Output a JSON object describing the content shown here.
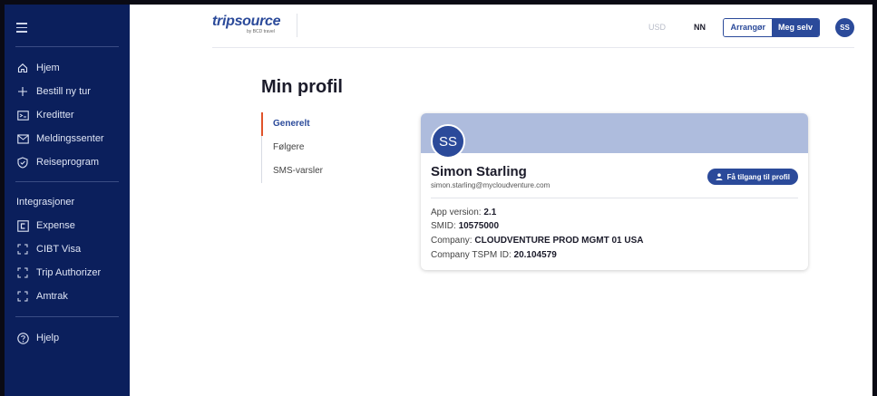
{
  "sidebar": {
    "items": [
      {
        "label": "Hjem",
        "icon": "home-icon"
      },
      {
        "label": "Bestill ny tur",
        "icon": "plus-icon"
      },
      {
        "label": "Kreditter",
        "icon": "credit-icon"
      },
      {
        "label": "Meldingssenter",
        "icon": "mail-icon"
      },
      {
        "label": "Reiseprogram",
        "icon": "shield-check-icon"
      }
    ],
    "section_title": "Integrasjoner",
    "integrations": [
      {
        "label": "Expense",
        "icon": "expense-icon"
      },
      {
        "label": "CIBT Visa",
        "icon": "bracket-icon"
      },
      {
        "label": "Trip Authorizer",
        "icon": "bracket-icon"
      },
      {
        "label": "Amtrak",
        "icon": "bracket-icon"
      }
    ],
    "help": {
      "label": "Hjelp",
      "icon": "help-icon"
    }
  },
  "header": {
    "logo_text_trip": "trip",
    "logo_text_source": "source",
    "logo_sub": "by BCD travel",
    "currency": "USD",
    "language": "NN",
    "toggle_left": "Arrangør",
    "toggle_right": "Meg selv",
    "avatar": "SS"
  },
  "page": {
    "title": "Min profil",
    "tabs": [
      "Generelt",
      "Følgere",
      "SMS-varsler"
    ],
    "active_tab": "Generelt"
  },
  "profile": {
    "initials": "SS",
    "name": "Simon Starling",
    "email": "simon.starling@mycloudventure.com",
    "access_button": "Få tilgang til profil",
    "app_version_label": "App version: ",
    "app_version": "2.1",
    "smid_label": "SMID: ",
    "smid": "10575000",
    "company_label": "Company: ",
    "company": "CLOUDVENTURE PROD MGMT 01 USA",
    "tspm_label": "Company TSPM ID: ",
    "tspm": "20.104579"
  },
  "colors": {
    "sidebar_bg": "#0b1f5c",
    "accent": "#2b4a9a",
    "banner": "#aebcdd",
    "active_tab_marker": "#e0532b"
  }
}
